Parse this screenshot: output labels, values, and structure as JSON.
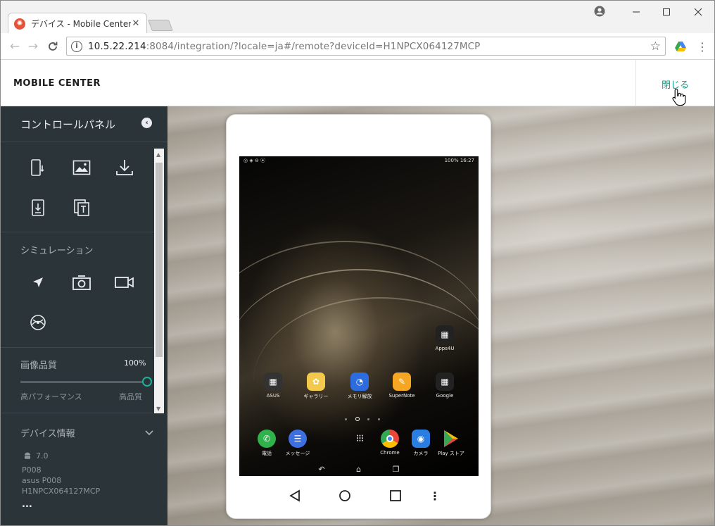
{
  "browser": {
    "tab_title": "デバイス - Mobile Center",
    "url_host": "10.5.22.214",
    "url_rest": ":8084/integration/?locale=ja#/remote?deviceId=H1NPCX064127MCP"
  },
  "app": {
    "brand": "MOBILE CENTER",
    "close_label": "閉じる"
  },
  "sidebar": {
    "title": "コントロールパネル",
    "simulation_label": "シミュレーション",
    "quality_label": "画像品質",
    "quality_value": "100%",
    "quality_fraction": 1.0,
    "slider_min_label": "高パフォーマンス",
    "slider_max_label": "高品質",
    "device_info_label": "デバイス情報",
    "device": {
      "os_version": "7.0",
      "model": "P008",
      "manufacturer_model": "asus P008",
      "serial": "H1NPCX064127MCP",
      "more": "..."
    }
  },
  "phone": {
    "status_right": "100% 16:27",
    "apps": [
      {
        "label": "Apps4U",
        "color": "#222222"
      },
      {
        "label": "ASUS",
        "color": "#333333"
      },
      {
        "label": "ギャラリー",
        "color": "#f2c94c"
      },
      {
        "label": "メモリ解放",
        "color": "#2d6cdf"
      },
      {
        "label": "SuperNote",
        "color": "#f5a623"
      },
      {
        "label": "Google",
        "color": "#222222"
      }
    ],
    "dock": [
      {
        "label": "電話",
        "color": "#2fb24c"
      },
      {
        "label": "メッセージ",
        "color": "#3d6fe0"
      },
      {
        "label": "Chrome",
        "color": "#e9473b"
      },
      {
        "label": "カメラ",
        "color": "#2a7de1"
      },
      {
        "label": "Play ストア",
        "color": "#1e88e5"
      }
    ]
  },
  "colors": {
    "accent": "#1a9a86",
    "sidebar_bg": "#2b3439"
  }
}
